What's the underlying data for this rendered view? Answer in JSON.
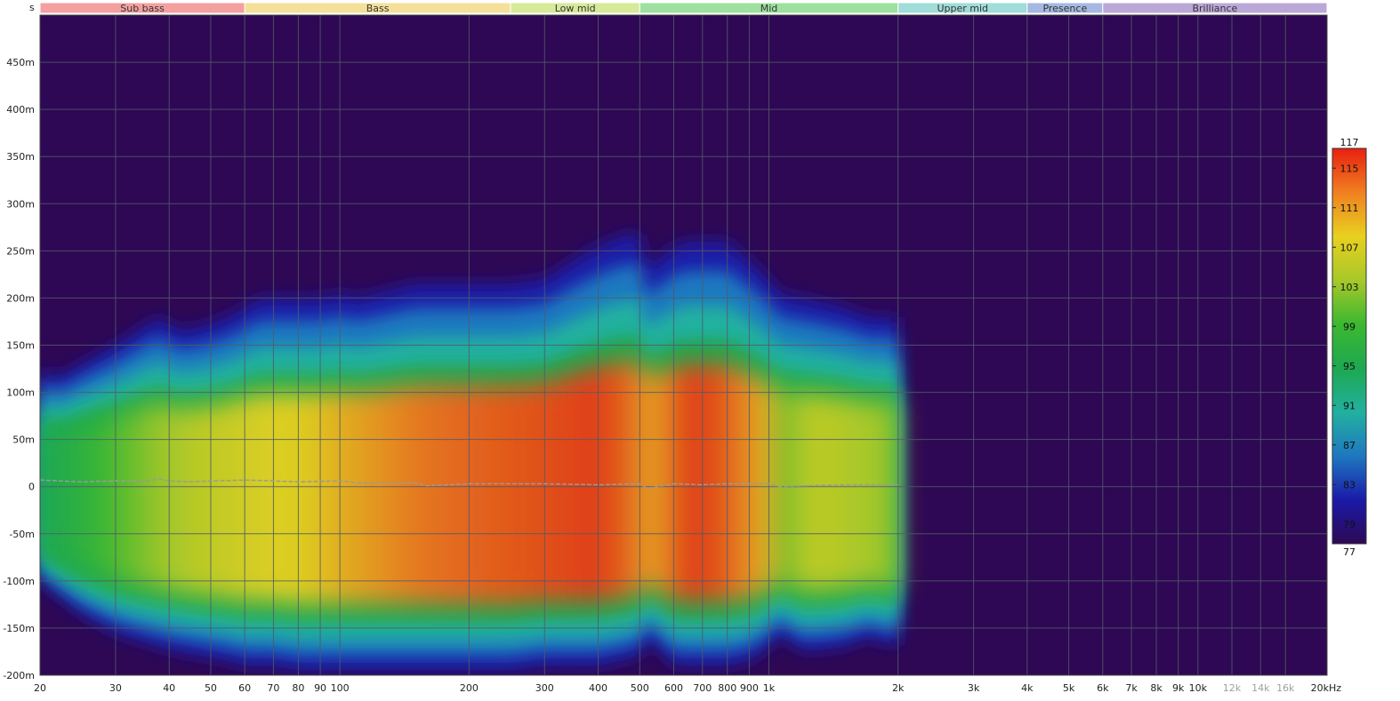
{
  "chart_data": {
    "type": "heatmap",
    "title": "",
    "xlabel": "",
    "ylabel": "s",
    "x_scale": "log",
    "xlim": [
      20,
      20000
    ],
    "ylim": [
      -0.2,
      0.5
    ],
    "grid": true,
    "colorbar_range": [
      77,
      117
    ],
    "colorbar_placement": "right",
    "band_header_placement": "top",
    "x_ticks": [
      {
        "value": 20,
        "label": "20",
        "muted": false
      },
      {
        "value": 30,
        "label": "30",
        "muted": false
      },
      {
        "value": 40,
        "label": "40",
        "muted": false
      },
      {
        "value": 50,
        "label": "50",
        "muted": false
      },
      {
        "value": 60,
        "label": "60",
        "muted": false
      },
      {
        "value": 70,
        "label": "70",
        "muted": false
      },
      {
        "value": 80,
        "label": "80",
        "muted": false
      },
      {
        "value": 90,
        "label": "90",
        "muted": false
      },
      {
        "value": 100,
        "label": "100",
        "muted": false
      },
      {
        "value": 200,
        "label": "200",
        "muted": false
      },
      {
        "value": 300,
        "label": "300",
        "muted": false
      },
      {
        "value": 400,
        "label": "400",
        "muted": false
      },
      {
        "value": 500,
        "label": "500",
        "muted": false
      },
      {
        "value": 600,
        "label": "600",
        "muted": false
      },
      {
        "value": 700,
        "label": "700",
        "muted": false
      },
      {
        "value": 800,
        "label": "800",
        "muted": false
      },
      {
        "value": 900,
        "label": "900",
        "muted": false
      },
      {
        "value": 1000,
        "label": "1k",
        "muted": false
      },
      {
        "value": 2000,
        "label": "2k",
        "muted": false
      },
      {
        "value": 3000,
        "label": "3k",
        "muted": false
      },
      {
        "value": 4000,
        "label": "4k",
        "muted": false
      },
      {
        "value": 5000,
        "label": "5k",
        "muted": false
      },
      {
        "value": 6000,
        "label": "6k",
        "muted": false
      },
      {
        "value": 7000,
        "label": "7k",
        "muted": false
      },
      {
        "value": 8000,
        "label": "8k",
        "muted": false
      },
      {
        "value": 9000,
        "label": "9k",
        "muted": false
      },
      {
        "value": 10000,
        "label": "10k",
        "muted": false
      },
      {
        "value": 12000,
        "label": "12k",
        "muted": true
      },
      {
        "value": 14000,
        "label": "14k",
        "muted": true
      },
      {
        "value": 16000,
        "label": "16k",
        "muted": true
      },
      {
        "value": 20000,
        "label": "20kHz",
        "muted": false
      }
    ],
    "y_ticks": [
      {
        "value": 0.45,
        "label": "450m"
      },
      {
        "value": 0.4,
        "label": "400m"
      },
      {
        "value": 0.35,
        "label": "350m"
      },
      {
        "value": 0.3,
        "label": "300m"
      },
      {
        "value": 0.25,
        "label": "250m"
      },
      {
        "value": 0.2,
        "label": "200m"
      },
      {
        "value": 0.15,
        "label": "150m"
      },
      {
        "value": 0.1,
        "label": "100m"
      },
      {
        "value": 0.05,
        "label": "50m"
      },
      {
        "value": 0,
        "label": "0"
      },
      {
        "value": -0.05,
        "label": "-50m"
      },
      {
        "value": -0.1,
        "label": "-100m"
      },
      {
        "value": -0.15,
        "label": "-150m"
      },
      {
        "value": -0.2,
        "label": "-200m"
      }
    ],
    "bands": [
      {
        "label": "Sub bass",
        "from": 20,
        "to": 60,
        "color": "#f4a0a0"
      },
      {
        "label": "Bass",
        "from": 60,
        "to": 250,
        "color": "#f5e09a"
      },
      {
        "label": "Low mid",
        "from": 250,
        "to": 500,
        "color": "#d6ea9a"
      },
      {
        "label": "Mid",
        "from": 500,
        "to": 2000,
        "color": "#9ee0a0"
      },
      {
        "label": "Upper mid",
        "from": 2000,
        "to": 4000,
        "color": "#a0dcd8"
      },
      {
        "label": "Presence",
        "from": 4000,
        "to": 6000,
        "color": "#a6b8e2"
      },
      {
        "label": "Brilliance",
        "from": 6000,
        "to": 20000,
        "color": "#bca8d8"
      }
    ],
    "colorbar_ticks": [
      {
        "value": 117,
        "label": "117"
      },
      {
        "value": 115,
        "label": "115"
      },
      {
        "value": 111,
        "label": "111"
      },
      {
        "value": 107,
        "label": "107"
      },
      {
        "value": 103,
        "label": "103"
      },
      {
        "value": 99,
        "label": "99"
      },
      {
        "value": 95,
        "label": "95"
      },
      {
        "value": 91,
        "label": "91"
      },
      {
        "value": 87,
        "label": "87"
      },
      {
        "value": 83,
        "label": "83"
      },
      {
        "value": 79,
        "label": "79"
      },
      {
        "value": 77,
        "label": "77"
      }
    ],
    "colormap": [
      "#2e0854",
      "#1a1aa8",
      "#1e78c0",
      "#22b0a0",
      "#1ea850",
      "#3cb830",
      "#a8c828",
      "#e8d020",
      "#f08020",
      "#e82010"
    ],
    "background_color": "#2e0854",
    "grid_color": "#505a6a",
    "frequency_extent_hz": [
      20,
      2000
    ],
    "surface_envelope": {
      "freq": [
        20,
        22,
        25,
        30,
        35,
        38,
        42,
        48,
        55,
        60,
        65,
        70,
        80,
        90,
        100,
        110,
        150,
        160,
        200,
        250,
        300,
        350,
        400,
        450,
        500,
        520,
        550,
        600,
        650,
        700,
        800,
        900,
        1000,
        1050,
        1200,
        1500,
        1700,
        2000
      ],
      "top_s": [
        0.125,
        0.115,
        0.13,
        0.15,
        0.17,
        0.18,
        0.165,
        0.17,
        0.18,
        0.19,
        0.2,
        0.2,
        0.2,
        0.2,
        0.205,
        0.2,
        0.215,
        0.215,
        0.215,
        0.215,
        0.22,
        0.24,
        0.255,
        0.265,
        0.27,
        0.23,
        0.24,
        0.255,
        0.26,
        0.26,
        0.26,
        0.24,
        0.22,
        0.205,
        0.2,
        0.19,
        0.18,
        0.18
      ],
      "bottom_s": [
        -0.1,
        -0.115,
        -0.135,
        -0.155,
        -0.165,
        -0.17,
        -0.175,
        -0.18,
        -0.185,
        -0.19,
        -0.19,
        -0.19,
        -0.195,
        -0.195,
        -0.195,
        -0.195,
        -0.195,
        -0.195,
        -0.195,
        -0.195,
        -0.19,
        -0.19,
        -0.19,
        -0.185,
        -0.18,
        -0.16,
        -0.17,
        -0.19,
        -0.19,
        -0.19,
        -0.19,
        -0.185,
        -0.17,
        -0.155,
        -0.175,
        -0.17,
        -0.16,
        -0.17
      ]
    },
    "peak_level_db": {
      "freq": [
        20,
        30,
        40,
        50,
        60,
        70,
        80,
        100,
        150,
        200,
        300,
        400,
        500,
        520,
        600,
        700,
        800,
        900,
        1000,
        1050,
        1200,
        1500,
        1700,
        2000
      ],
      "level": [
        94,
        100,
        104,
        106,
        107,
        108,
        108,
        110,
        113,
        114,
        115,
        116,
        113,
        108,
        115,
        116,
        114,
        112,
        110,
        98,
        106,
        105,
        104,
        103
      ]
    },
    "series": [
      {
        "x": [
          20,
          25,
          30,
          35,
          38,
          40,
          45,
          50,
          60,
          70,
          80,
          100,
          110,
          150,
          160,
          200,
          300,
          400,
          500,
          520,
          600,
          700,
          800,
          1000,
          1050,
          1500,
          2000
        ],
        "y": [
          0.007,
          0.005,
          0.006,
          0.006,
          0.008,
          0.006,
          0.005,
          0.006,
          0.007,
          0.006,
          0.005,
          0.006,
          0.004,
          0.004,
          0.001,
          0.003,
          0.003,
          0.002,
          0.003,
          -0.002,
          0.003,
          0.002,
          0.003,
          0.003,
          0.0,
          0.002,
          0.002
        ],
        "color": "#9a9a9a"
      }
    ]
  }
}
